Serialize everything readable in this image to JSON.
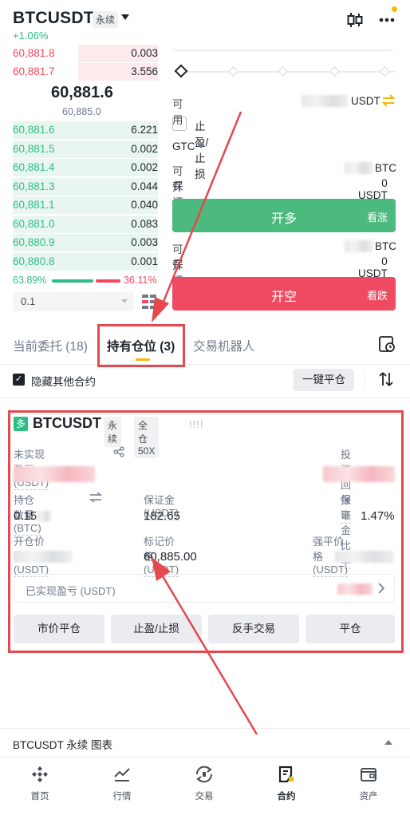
{
  "header": {
    "symbol": "BTCUSDT",
    "contract_type": "永续",
    "change_pct": "+1.06%",
    "icons": [
      "candlestick-icon",
      "more-icon"
    ]
  },
  "orderbook": {
    "asks": [
      {
        "price": "60,881.8",
        "qty": "0.003"
      },
      {
        "price": "60,881.7",
        "qty": "3.556"
      }
    ],
    "mid_price": "60,881.6",
    "mark_price": "60,885.0",
    "bids": [
      {
        "price": "60,881.6",
        "qty": "6.221"
      },
      {
        "price": "60,881.5",
        "qty": "0.002"
      },
      {
        "price": "60,881.4",
        "qty": "0.002"
      },
      {
        "price": "60,881.3",
        "qty": "0.044"
      },
      {
        "price": "60,881.1",
        "qty": "0.040"
      },
      {
        "price": "60,881.0",
        "qty": "0.083"
      },
      {
        "price": "60,880.9",
        "qty": "0.003"
      },
      {
        "price": "60,880.8",
        "qty": "0.001"
      }
    ],
    "buy_ratio": "63.89%",
    "sell_ratio": "36.11%",
    "buy_ratio_value": 0.6389,
    "depth_step": "0.1"
  },
  "trade_panel": {
    "available_label": "可用",
    "available_unit": "USDT",
    "tpsl_label": "止盈/止损",
    "tif": "GTC",
    "long": {
      "can_open_label": "可开",
      "can_open_unit": "BTC",
      "margin_label": "保证金",
      "margin_value": "0 USDT",
      "button": "开多",
      "hint": "看涨"
    },
    "short": {
      "can_open_label": "可开",
      "can_open_unit": "BTC",
      "margin_label": "保证金",
      "margin_value": "0 USDT",
      "button": "开空",
      "hint": "看跌"
    }
  },
  "tabs": {
    "items": [
      "当前委托 (18)",
      "持有仓位 (3)",
      "交易机器人"
    ],
    "active_index": 1
  },
  "filter": {
    "hide_other_label": "隐藏其他合约",
    "close_all": "一键平仓"
  },
  "position": {
    "side_tag": "多",
    "symbol": "BTCUSDT",
    "contract_type": "永续",
    "margin_mode": "全仓 50X",
    "leverage_marks": "!!!!",
    "unrealized_label": "未实现盈亏 (USDT)",
    "roi_label": "投资回报率",
    "size_label": "持仓数量(BTC)",
    "size_value": "0.15",
    "margin_label": "保证金 (USDT)",
    "margin_value": "182.65",
    "margin_ratio_label": "保证金比率",
    "margin_ratio_value": "1.47%",
    "entry_label": "开仓价格 (USDT)",
    "mark_label": "标记价格 (USDT)",
    "mark_value": "60,885.00",
    "liq_label": "强平价格 (USDT)",
    "realized_label": "已实现盈亏 (USDT)",
    "actions": [
      "市价平仓",
      "止盈/止损",
      "反手交易",
      "平仓"
    ]
  },
  "chart_bar": {
    "title": "BTCUSDT 永续 图表"
  },
  "bottom_nav": [
    {
      "label": "首页",
      "icon": "home-icon"
    },
    {
      "label": "行情",
      "icon": "markets-icon"
    },
    {
      "label": "交易",
      "icon": "trade-icon"
    },
    {
      "label": "合约",
      "icon": "futures-icon"
    },
    {
      "label": "资产",
      "icon": "wallet-icon"
    }
  ],
  "colors": {
    "buy": "#2ebd85",
    "sell": "#f6465d",
    "accent": "#f0b90b",
    "annotation": "#e5484d"
  }
}
